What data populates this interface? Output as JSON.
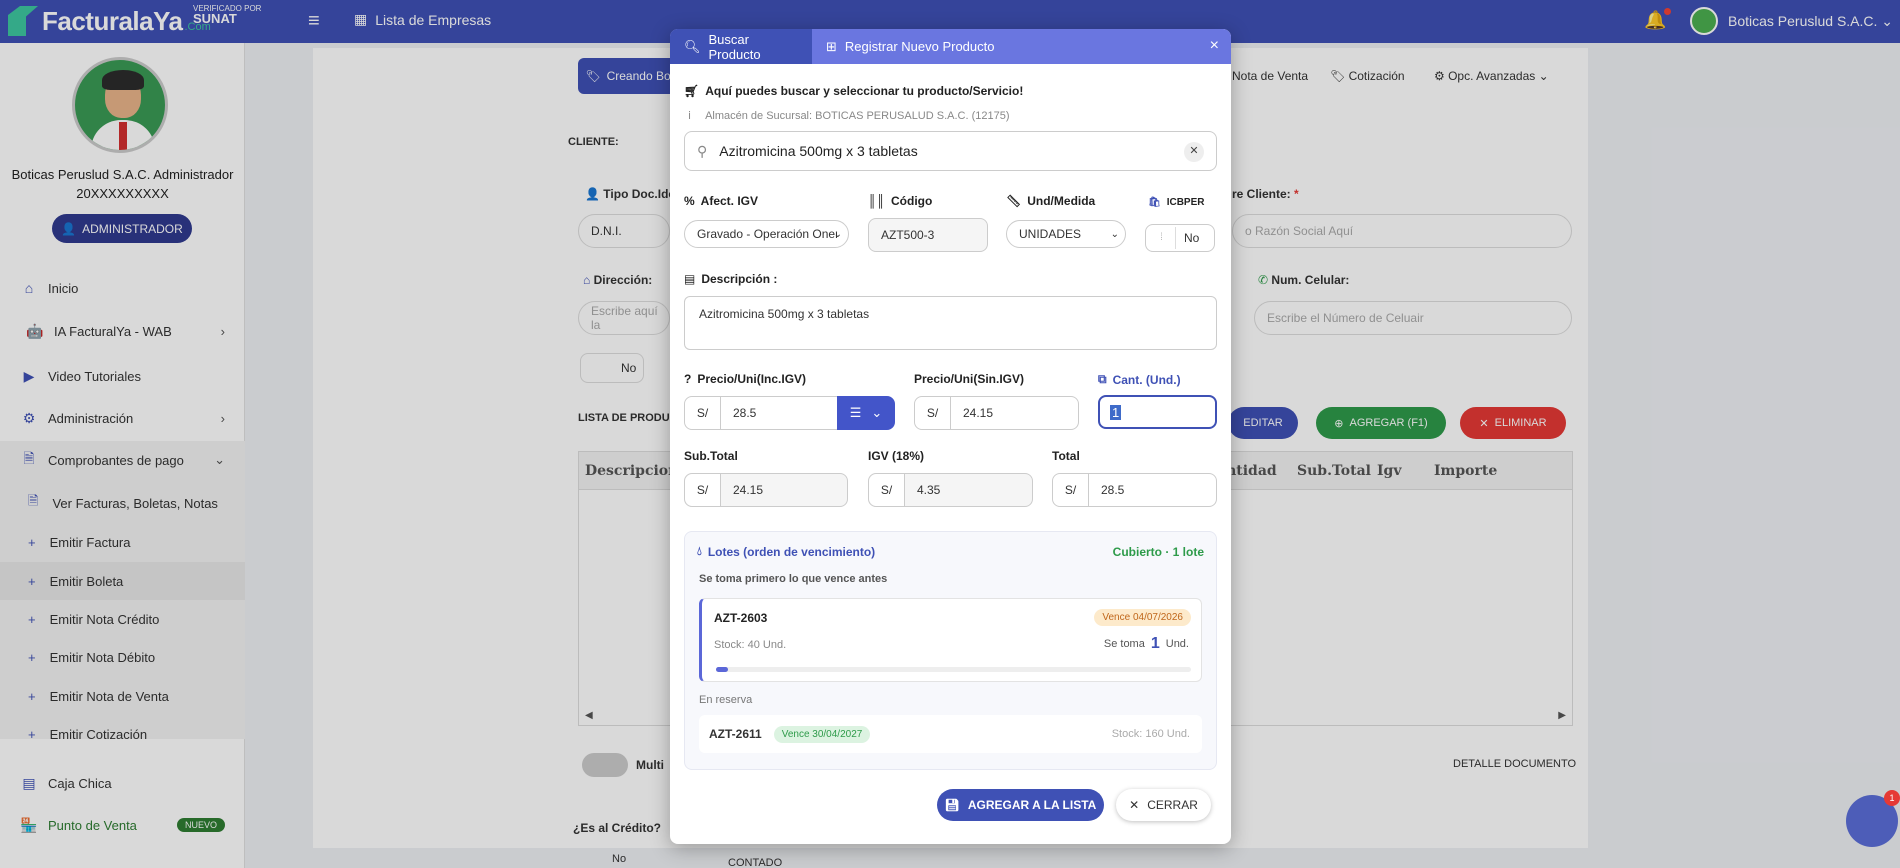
{
  "topbar": {
    "brand": "FacturalaYa",
    "brand_suffix": ".Com",
    "sunat_line1": "VERIFICADO POR",
    "sunat_line2": "SUNAT",
    "empresas_label": "Lista de Empresas",
    "user_label": "Boticas Peruslud S.A.C."
  },
  "sidebar": {
    "profile_name": "Boticas Peruslud S.A.C. Administrador",
    "profile_ruc": "20XXXXXXXXX",
    "role_button": "ADMINISTRADOR",
    "items": [
      {
        "label": "Inicio",
        "icon": "home-icon"
      },
      {
        "label": "IA FacturalYa - WAB",
        "icon": "robot-icon"
      },
      {
        "label": "Video Tutoriales",
        "icon": "video-icon"
      },
      {
        "label": "Administración",
        "icon": "gear-icon"
      },
      {
        "label": "Comprobantes de pago",
        "icon": "document-icon"
      }
    ],
    "subitems": [
      "Ver Facturas, Boletas, Notas",
      "Emitir Factura",
      "Emitir Boleta",
      "Emitir Nota Crédito",
      "Emitir Nota Débito",
      "Emitir Nota de Venta",
      "Emitir Cotización"
    ],
    "caja": "Caja Chica",
    "pos": "Punto de Venta",
    "pos_badge": "NUEVO"
  },
  "background": {
    "creando_tab": "Creando Bo",
    "nota_venta_tab": "Nota de Venta",
    "cotizacion_tab": "Cotización",
    "opc_avanzadas": "Opc. Avanzadas",
    "cliente_label": "CLIENTE:",
    "tipo_doc_label": "Tipo Doc.Ide",
    "tipo_doc_value": "D.N.I.",
    "nombre_cliente_label": "re Cliente:",
    "nombre_cliente_placeholder": "o Razón Social Aquí",
    "direccion_label": "Dirección:",
    "direccion_placeholder": "Escribe aquí la",
    "celular_label": "Num. Celular:",
    "celular_placeholder": "Escribe el Número de Celuair",
    "no_label": "No",
    "lista_label": "LISTA DE PRODUC",
    "editar_btn": "EDITAR",
    "agregar_btn": "AGREGAR (F1)",
    "eliminar_btn": "ELIMINAR",
    "table_headers": [
      "Descripcion",
      "antidad",
      "Sub.Total",
      "Igv",
      "Importe"
    ],
    "multi_label": "Multi",
    "detalle_label": "DETALLE DOCUMENTO",
    "credito_label": "¿Es al Crédito?",
    "credito_toggle": "No",
    "contado_value": "CONTADO"
  },
  "modal": {
    "tab_search": "Buscar Producto",
    "tab_register": "Registrar Nuevo Producto",
    "heading": "Aquí puedes buscar y seleccionar tu producto/Servicio!",
    "info": "Almacén de Sucursal: BOTICAS PERUSALUD S.A.C. (12175)",
    "search_value": "Azitromicina 500mg x 3 tabletas",
    "afect_label": "Afect. IGV",
    "afect_value": "Gravado - Operación Onerosa",
    "codigo_label": "Código",
    "codigo_value": "AZT500-3",
    "und_label": "Und/Medida",
    "und_value": "UNIDADES",
    "icbper_label": "ICBPER",
    "icbper_value": "No",
    "desc_label": "Descripción :",
    "desc_value": "Azitromicina 500mg x 3 tabletas",
    "precio_inc_label": "Precio/Uni(Inc.IGV)",
    "precio_inc_value": "28.5",
    "precio_sin_label": "Precio/Uni(Sin.IGV)",
    "precio_sin_value": "24.15",
    "cant_label": "Cant. (Und.)",
    "cant_value": "1",
    "currency": "S/",
    "subtotal_label": "Sub.Total",
    "subtotal_value": "24.15",
    "igv_label": "IGV (18%)",
    "igv_value": "4.35",
    "total_label": "Total",
    "total_value": "28.5",
    "lotes_title": "Lotes (orden de vencimiento)",
    "lotes_status": "Cubierto · 1 lote",
    "lotes_sub": "Se toma primero lo que vence antes",
    "lot1_code": "AZT-2603",
    "lot1_expiry": "Vence 04/07/2026",
    "lot1_stock": "Stock: 40 Und.",
    "lot1_take_label": "Se toma",
    "lot1_take_qty": "1",
    "lot1_take_unit": "Und.",
    "lot1_fraction": 0.025,
    "reserve_label": "En reserva",
    "lot2_code": "AZT-2611",
    "lot2_expiry": "Vence 30/04/2027",
    "lot2_stock": "Stock: 160 Und.",
    "add_button": "AGREGAR A LA LISTA",
    "close_button": "CERRAR"
  },
  "float_badge": "1",
  "colors": {
    "primary": "#3f51b5",
    "accent": "#3ec7a0",
    "green": "#2e9b4a",
    "danger": "#e53935"
  }
}
